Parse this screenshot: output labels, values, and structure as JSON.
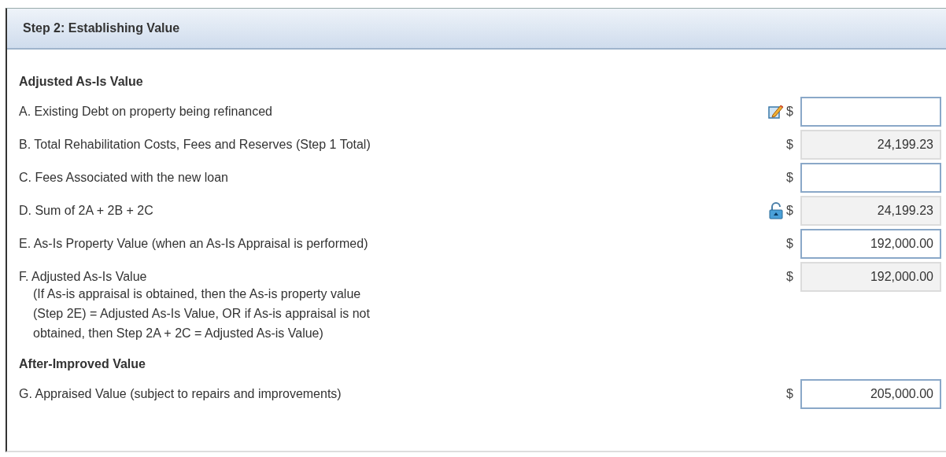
{
  "panel": {
    "title": "Step 2: Establishing Value"
  },
  "sections": [
    {
      "title": "Adjusted As-Is Value",
      "rows": [
        {
          "label": "A. Existing Debt on property being refinanced",
          "kind": "editable",
          "currency": "$",
          "field": {
            "readonly": false
          }
        },
        {
          "label": "B. Total Rehabilitation Costs, Fees and Reserves (Step 1 Total)",
          "kind": "plain",
          "currency": "$",
          "field": {
            "value": "24,199.23",
            "readonly": true
          }
        },
        {
          "label": "C. Fees Associated with the new loan",
          "kind": "plain",
          "currency": "$",
          "field": {
            "readonly": false
          }
        },
        {
          "label": "D. Sum of 2A + 2B + 2C",
          "kind": "locked",
          "currency": "$",
          "field": {
            "value": "24,199.23",
            "readonly": true
          }
        },
        {
          "label": "E. As-Is Property Value (when an As-Is Appraisal is performed)",
          "kind": "plain",
          "currency": "$",
          "field": {
            "value": "192,000.00",
            "readonly": false
          }
        },
        {
          "label": "F. Adjusted As-Is Value",
          "note_lines": [
            "(If As-is appraisal is obtained, then the As-is property value",
            "(Step 2E) = Adjusted As-Is Value, OR if As-is appraisal is not",
            "obtained, then Step 2A + 2C = Adjusted As-is Value)"
          ],
          "kind": "plain",
          "currency": "$",
          "field": {
            "value": "192,000.00",
            "readonly": true
          }
        }
      ]
    },
    {
      "title": "After-Improved Value",
      "rows": [
        {
          "label": "G. Appraised Value (subject to repairs and improvements)",
          "kind": "plain",
          "currency": "$",
          "field": {
            "value": "205,000.00",
            "readonly": false
          }
        }
      ]
    }
  ]
}
